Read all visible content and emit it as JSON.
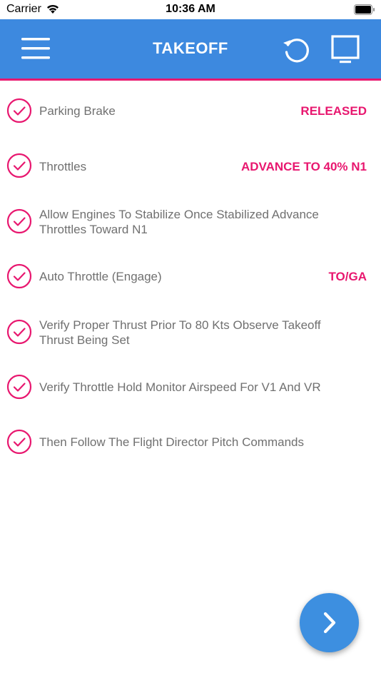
{
  "status_bar": {
    "carrier": "Carrier",
    "time": "10:36 AM"
  },
  "nav": {
    "title": "TAKEOFF"
  },
  "items": [
    {
      "label": "Parking Brake",
      "value": "RELEASED"
    },
    {
      "label": "Throttles",
      "value": "ADVANCE TO 40% N1"
    },
    {
      "label": "Allow Engines To Stabilize Once Stabilized Advance Throttles Toward N1",
      "value": ""
    },
    {
      "label": "Auto Throttle (Engage)",
      "value": "TO/GA"
    },
    {
      "label": "Verify Proper Thrust Prior To 80 Kts Observe Takeoff Thrust Being Set",
      "value": ""
    },
    {
      "label": "Verify Throttle Hold Monitor Airspeed For V1 And VR",
      "value": ""
    },
    {
      "label": "Then Follow The Flight Director Pitch Commands",
      "value": ""
    }
  ],
  "colors": {
    "nav_bg": "#3d89df",
    "accent": "#e8176f",
    "label_text": "#707070",
    "fab_bg": "#3d8fe0"
  },
  "icons": [
    "wifi-icon",
    "battery-icon",
    "menu-icon",
    "reset-icon",
    "display-icon",
    "check-circle-icon",
    "chevron-right-icon"
  ]
}
